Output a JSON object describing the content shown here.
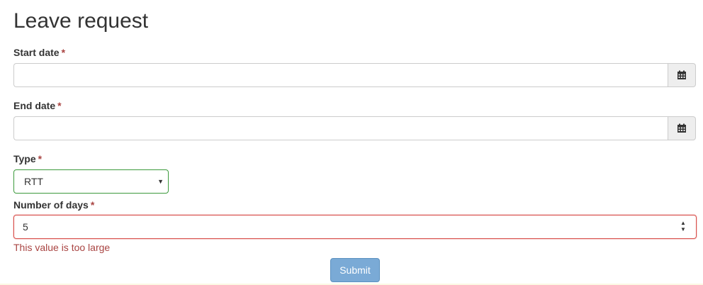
{
  "page": {
    "title": "Leave request"
  },
  "form": {
    "required_marker": "*",
    "start_date": {
      "label": "Start date",
      "value": "",
      "icon": "calendar-icon"
    },
    "end_date": {
      "label": "End date",
      "value": "",
      "icon": "calendar-icon"
    },
    "type": {
      "label": "Type",
      "selected": "RTT"
    },
    "days": {
      "label": "Number of days",
      "value": "5",
      "error": "This value is too large"
    },
    "submit_label": "Submit"
  },
  "colors": {
    "error": "#a94442",
    "valid_border": "#3c9a3c",
    "submit_bg": "#7aaad6"
  }
}
